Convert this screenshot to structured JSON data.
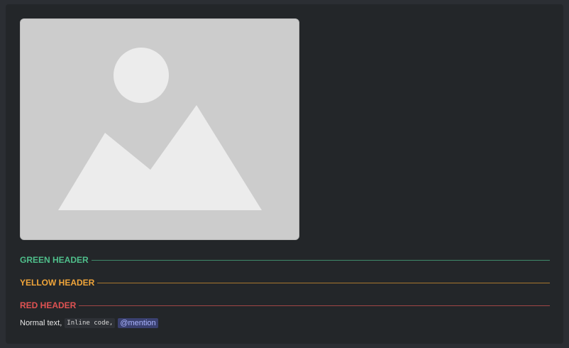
{
  "image": {
    "icon": "image-placeholder-icon"
  },
  "headers": [
    {
      "label": "GREEN HEADER",
      "color": "#4fbf8b"
    },
    {
      "label": "YELLOW HEADER",
      "color": "#f0a53a"
    },
    {
      "label": "RED HEADER",
      "color": "#e05252"
    }
  ],
  "content": {
    "normal_text": "Normal text,",
    "inline_code": "Inline code,",
    "mention": "@mention"
  },
  "colors": {
    "background": "#232629",
    "mention_bg": "#3a4070",
    "mention_fg": "#aab4ff"
  }
}
